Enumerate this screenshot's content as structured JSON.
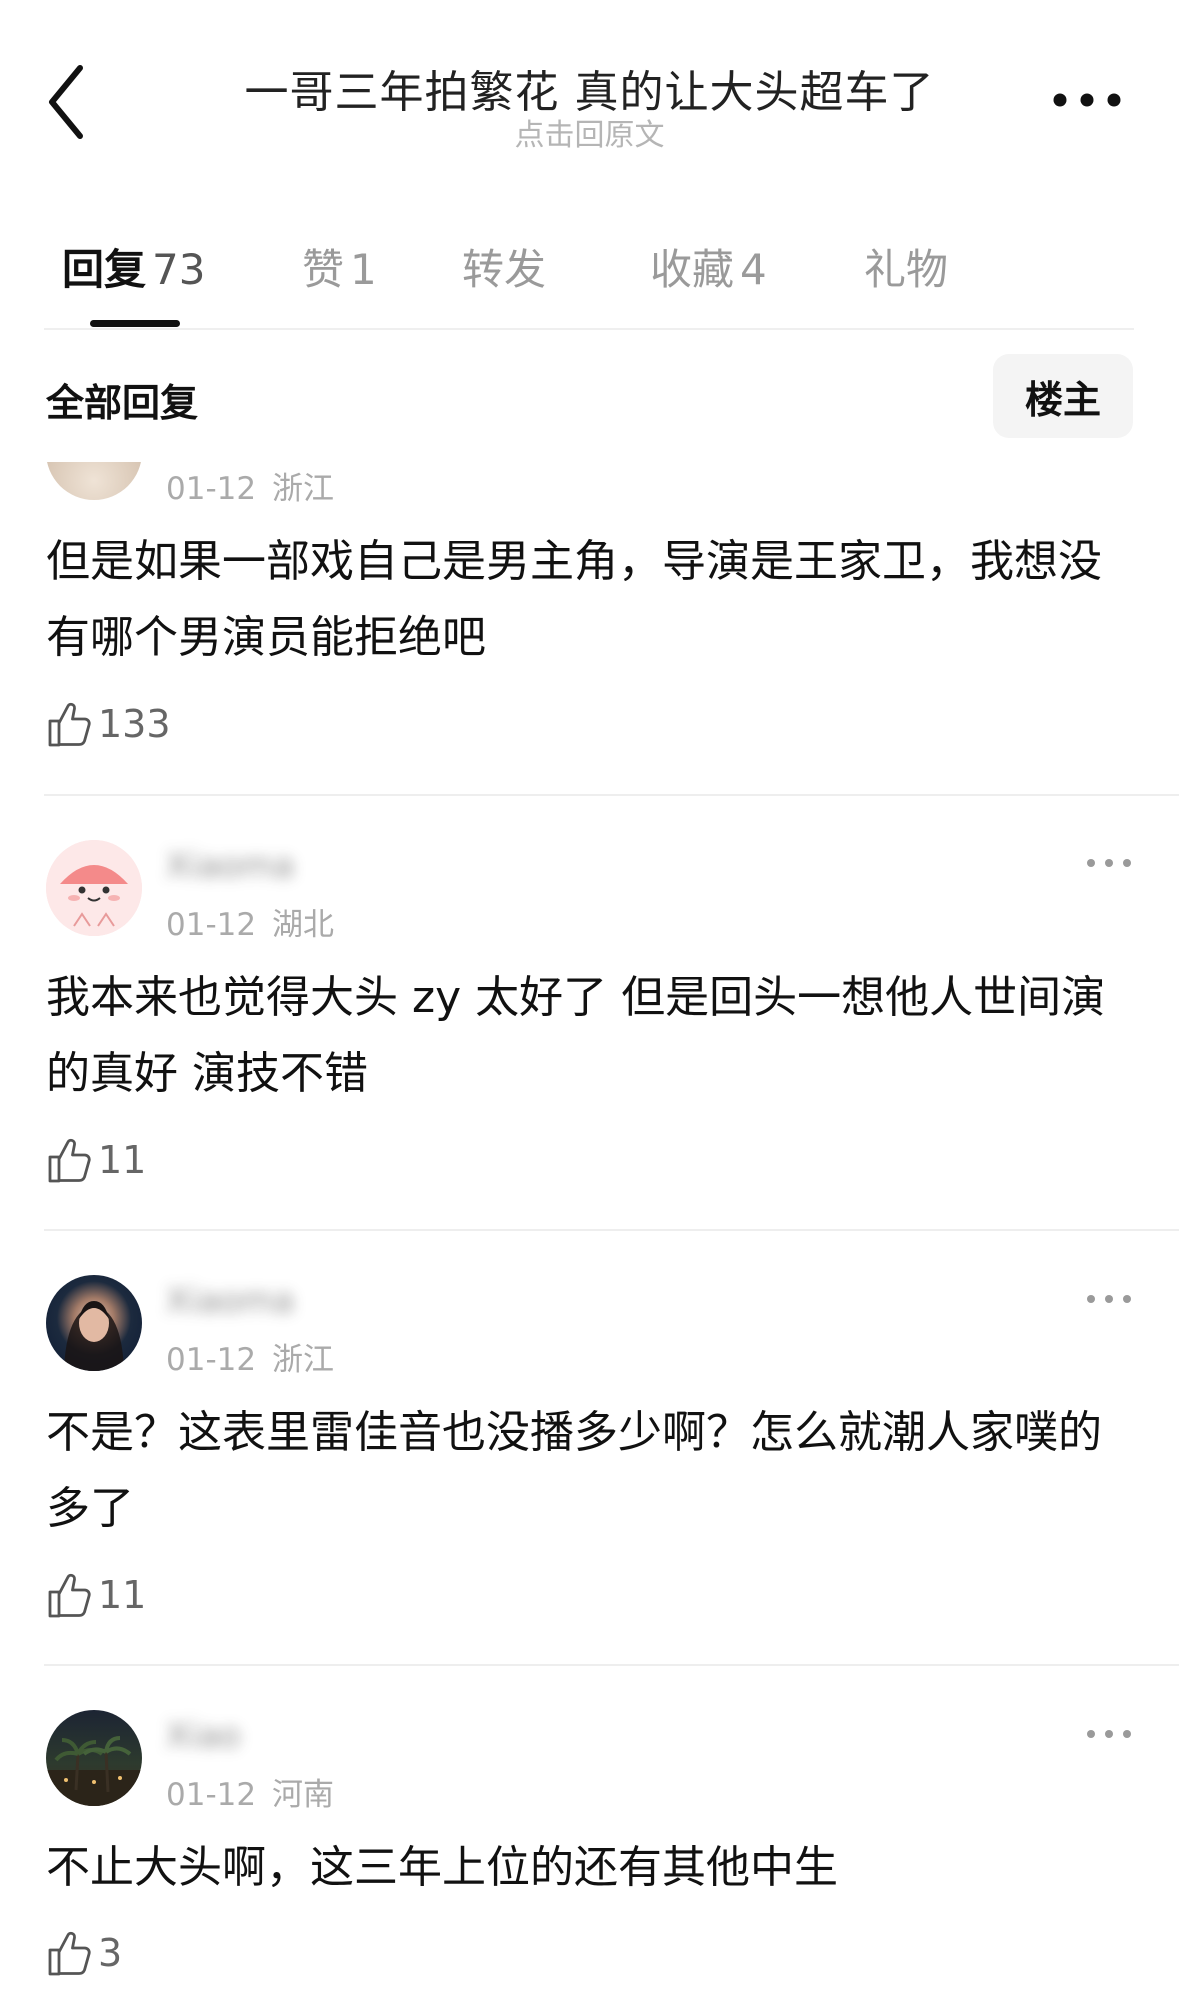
{
  "header": {
    "title": "一哥三年拍繁花 真的让大头超车了",
    "subtitle": "点击回原文"
  },
  "tabs": [
    {
      "label": "回复",
      "count": "73"
    },
    {
      "label": "赞",
      "count": "1"
    },
    {
      "label": "转发",
      "count": ""
    },
    {
      "label": "收藏",
      "count": "4"
    },
    {
      "label": "礼物",
      "count": ""
    }
  ],
  "filter": {
    "all_replies_label": "全部回复",
    "op_button_label": "楼主"
  },
  "comments": [
    {
      "username": "",
      "date": "01-12",
      "location": "浙江",
      "text": "但是如果一部戏自己是男主角，导演是王家卫，我想没有哪个男演员能拒绝吧",
      "likes": "133"
    },
    {
      "username": "",
      "date": "01-12",
      "location": "湖北",
      "text": "我本来也觉得大头 zy 太好了 但是回头一想他人世间演的真好 演技不错",
      "likes": "11"
    },
    {
      "username": "",
      "date": "01-12",
      "location": "浙江",
      "text": "不是？这表里雷佳音也没播多少啊？怎么就潮人家噗的多了",
      "likes": "11"
    },
    {
      "username": "",
      "date": "01-12",
      "location": "河南",
      "text": "不止大头啊，这三年上位的还有其他中生",
      "likes": "3"
    }
  ],
  "icons": {
    "back": "chevron-left-icon",
    "more": "more-horizontal-icon",
    "like": "thumbs-up-icon"
  }
}
